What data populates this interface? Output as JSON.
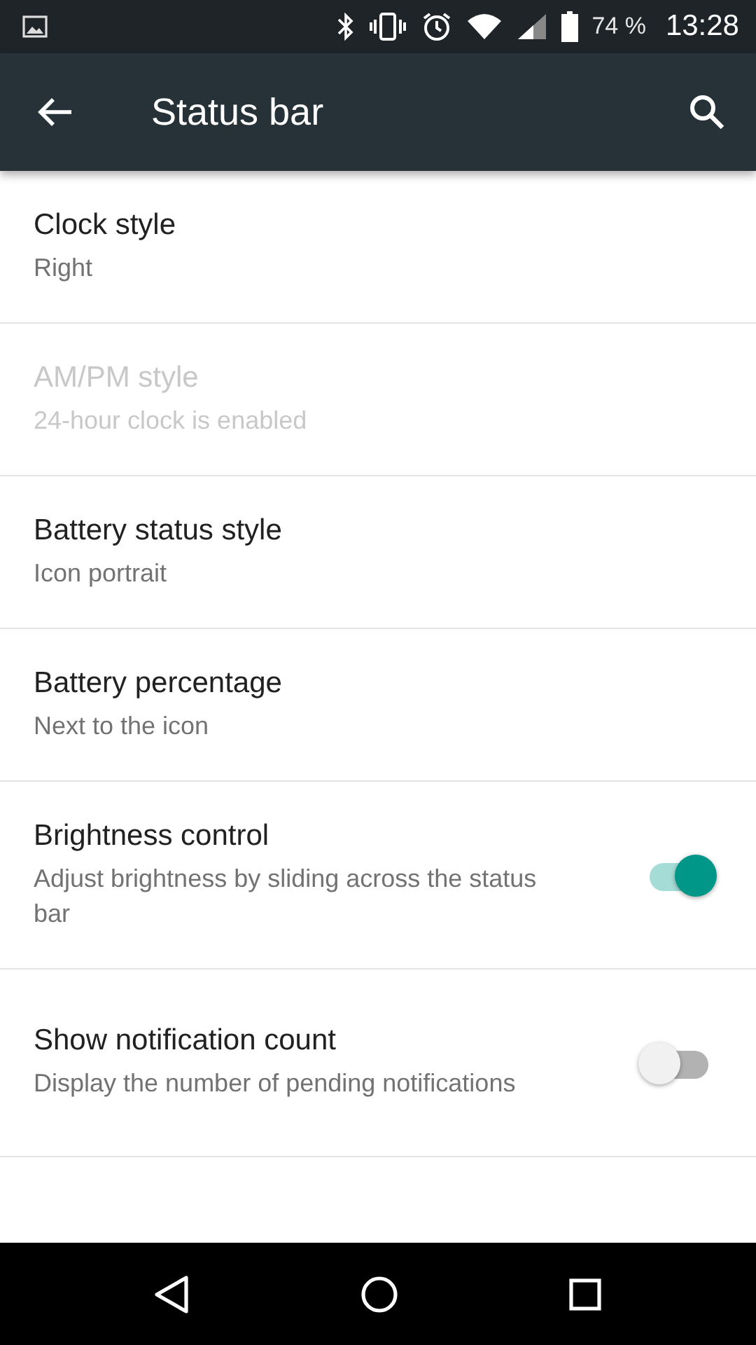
{
  "status_bar": {
    "battery_percent": "74 %",
    "time": "13:28"
  },
  "app_bar": {
    "title": "Status bar"
  },
  "settings": [
    {
      "kind": "value",
      "title": "Clock style",
      "summary": "Right",
      "disabled": false
    },
    {
      "kind": "value",
      "title": "AM/PM style",
      "summary": "24-hour clock is enabled",
      "disabled": true
    },
    {
      "kind": "value",
      "title": "Battery status style",
      "summary": "Icon portrait",
      "disabled": false
    },
    {
      "kind": "value",
      "title": "Battery percentage",
      "summary": "Next to the icon",
      "disabled": false
    },
    {
      "kind": "switch",
      "title": "Brightness control",
      "summary": "Adjust brightness by sliding across the status bar",
      "disabled": false,
      "on": true
    },
    {
      "kind": "switch",
      "title": "Show notification count",
      "summary": "Display the number of pending notifications",
      "disabled": false,
      "on": false
    }
  ]
}
